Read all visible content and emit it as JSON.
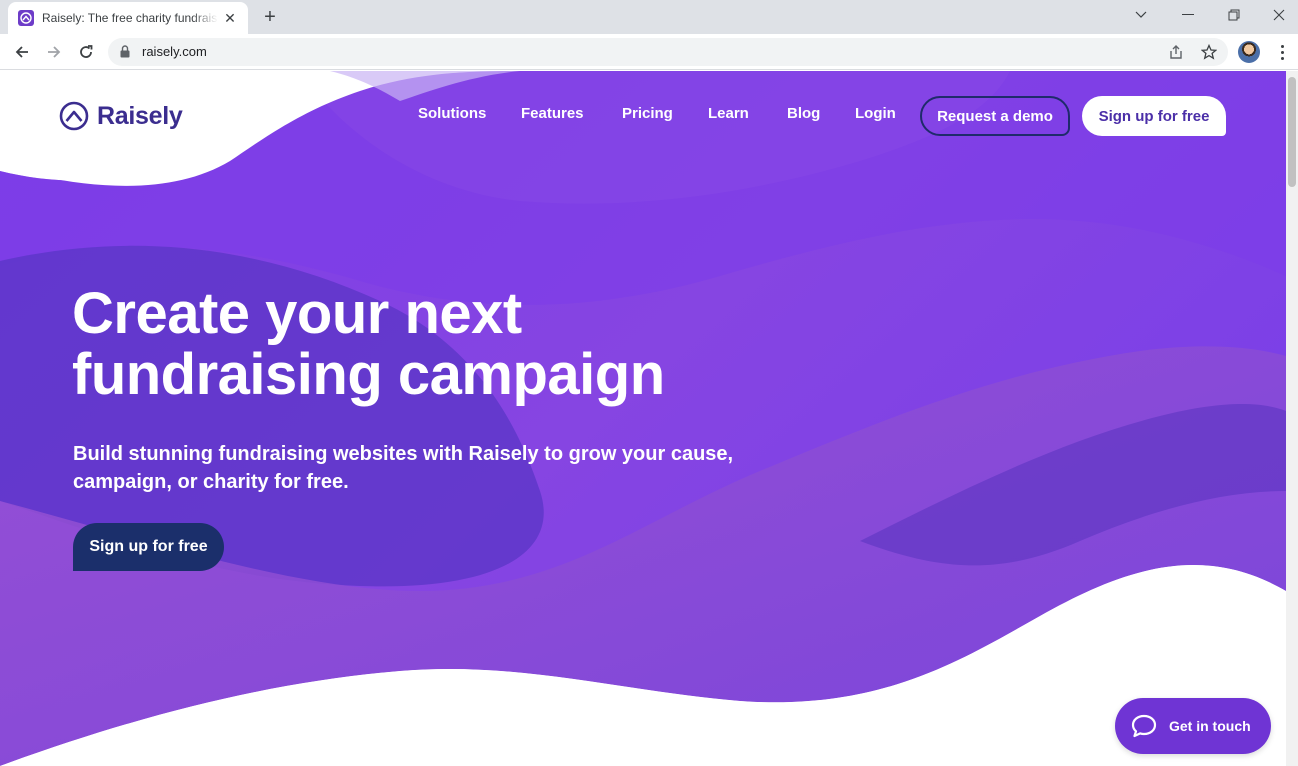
{
  "browser": {
    "tab_title": "Raisely: The free charity fundraising",
    "url": "raisely.com"
  },
  "site": {
    "logo_text": "Raisely",
    "nav": [
      "Solutions",
      "Features",
      "Pricing",
      "Learn",
      "Blog",
      "Login"
    ],
    "request_demo": "Request a demo",
    "signup_top": "Sign up for free"
  },
  "hero": {
    "title_line1": "Create your next",
    "title_line2": "fundraising campaign",
    "subtitle_line1": "Build stunning fundraising websites with Raisely to grow your cause,",
    "subtitle_line2": "campaign, or charity for free.",
    "cta": "Sign up for free"
  },
  "chat_widget": {
    "label": "Get in touch"
  },
  "colors": {
    "brand_purple": "#7b3fe4",
    "navy": "#1b2f6b",
    "logo_purple": "#3b2d8f"
  }
}
